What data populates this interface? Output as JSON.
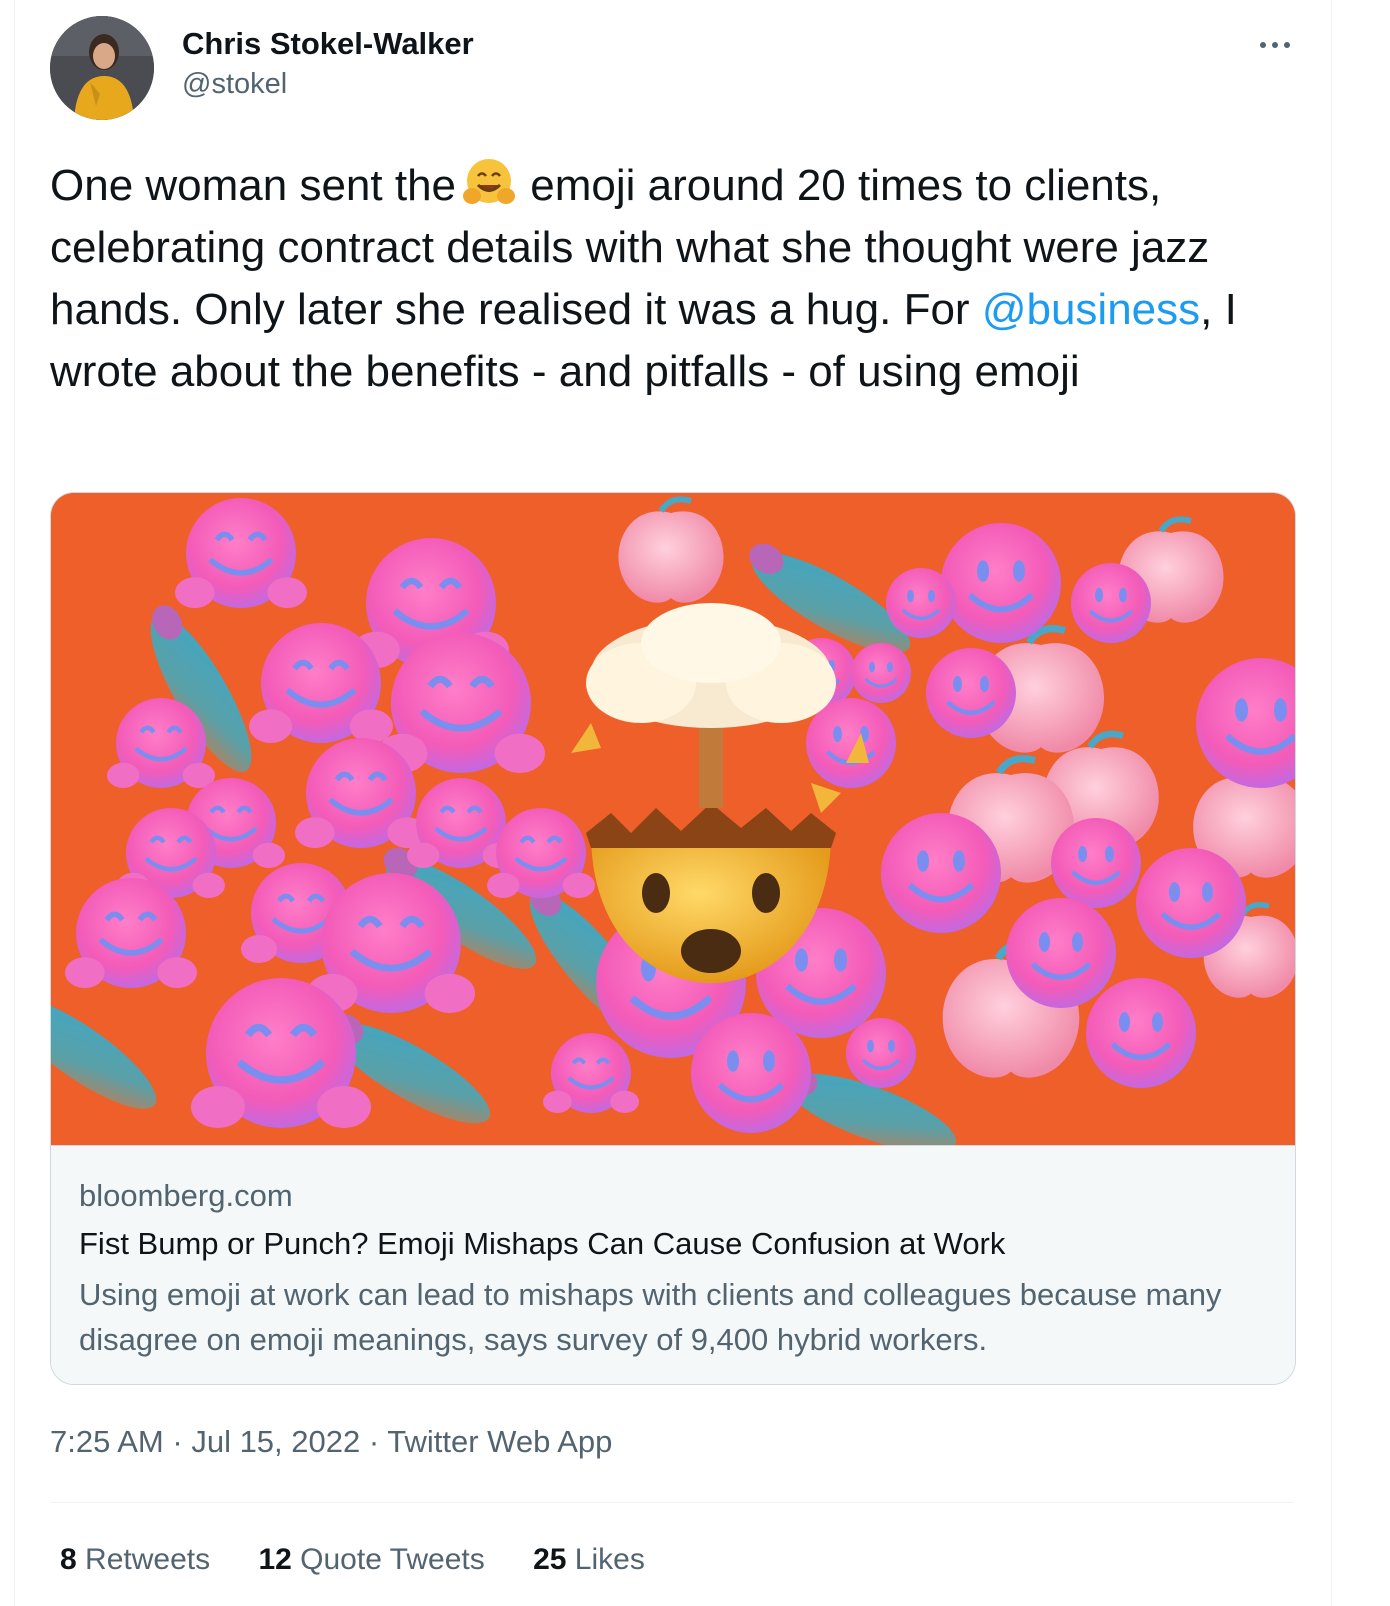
{
  "author": {
    "display_name": "Chris Stokel-Walker",
    "handle": "@stokel"
  },
  "tweet": {
    "text_part1": "One woman sent the",
    "emoji_name": "hugging-face",
    "text_part2": " emoji around 20 times to clients, celebrating contract details with what she thought were jazz hands. Only later she realised it was a hug. For ",
    "mention": "@business",
    "text_part3": ", I wrote about the benefits - and pitfalls - of using emoji"
  },
  "card": {
    "image_icon": "emoji-collage",
    "domain": "bloomberg.com",
    "title": "Fist Bump or Punch? Emoji Mishaps Can Cause Confusion at Work",
    "description": "Using emoji at work can lead to mishaps with clients and colleagues because many disagree on emoji meanings, says survey of 9,400 hybrid workers."
  },
  "meta": {
    "time": "7:25 AM",
    "separator": "·",
    "date": "Jul 15, 2022",
    "source": "Twitter Web App"
  },
  "stats": {
    "retweets_count": "8",
    "retweets_label": "Retweets",
    "quotes_count": "12",
    "quotes_label": "Quote Tweets",
    "likes_count": "25",
    "likes_label": "Likes"
  },
  "colors": {
    "link": "#1d9bf0",
    "secondary_text": "#536471",
    "card_background": "#ee5f29"
  }
}
